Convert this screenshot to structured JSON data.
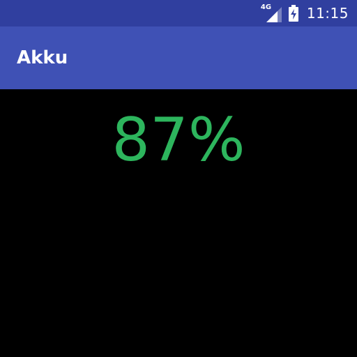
{
  "status_bar": {
    "network_label": "4G",
    "signal_icon": "cell-signal-icon",
    "battery_icon": "battery-charging-icon",
    "time": "11:15"
  },
  "app_bar": {
    "title": "Akku"
  },
  "main": {
    "battery_percent": "87%"
  },
  "colors": {
    "status_bar": "#303F9F",
    "app_bar": "#3F51B5",
    "background": "#000000",
    "percent_text": "#2DB55D"
  }
}
